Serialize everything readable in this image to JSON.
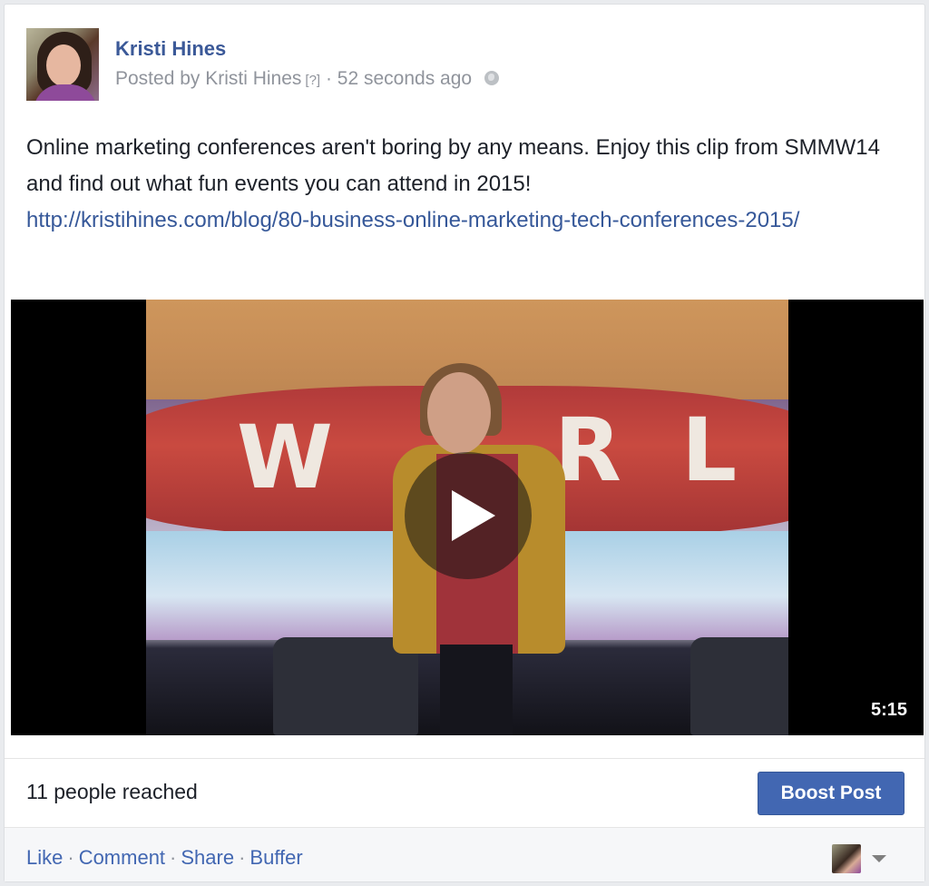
{
  "post": {
    "author": "Kristi Hines",
    "meta_prefix": "Posted by Kristi Hines",
    "meta_q": "[?]",
    "meta_time": "· 52 seconds ago",
    "text": "Online marketing conferences aren't boring by any means. Enjoy this clip from SMMW14 and find out what fun events you can attend in 2015!",
    "link": "http://kristihines.com/blog/80-business-online-marketing-tech-conferences-2015/"
  },
  "video": {
    "duration": "5:15",
    "banner_letters": [
      "W",
      "R",
      "L"
    ]
  },
  "reach": {
    "text": "11 people reached",
    "boost_label": "Boost Post"
  },
  "actions": {
    "like": "Like",
    "comment": "Comment",
    "share": "Share",
    "buffer": "Buffer",
    "sep": "·"
  },
  "icons": {
    "privacy": "globe-icon",
    "play": "play-icon",
    "dropdown": "caret-down-icon"
  },
  "colors": {
    "link": "#3b5998",
    "boost_button": "#4267b2",
    "meta_text": "#90949c"
  }
}
